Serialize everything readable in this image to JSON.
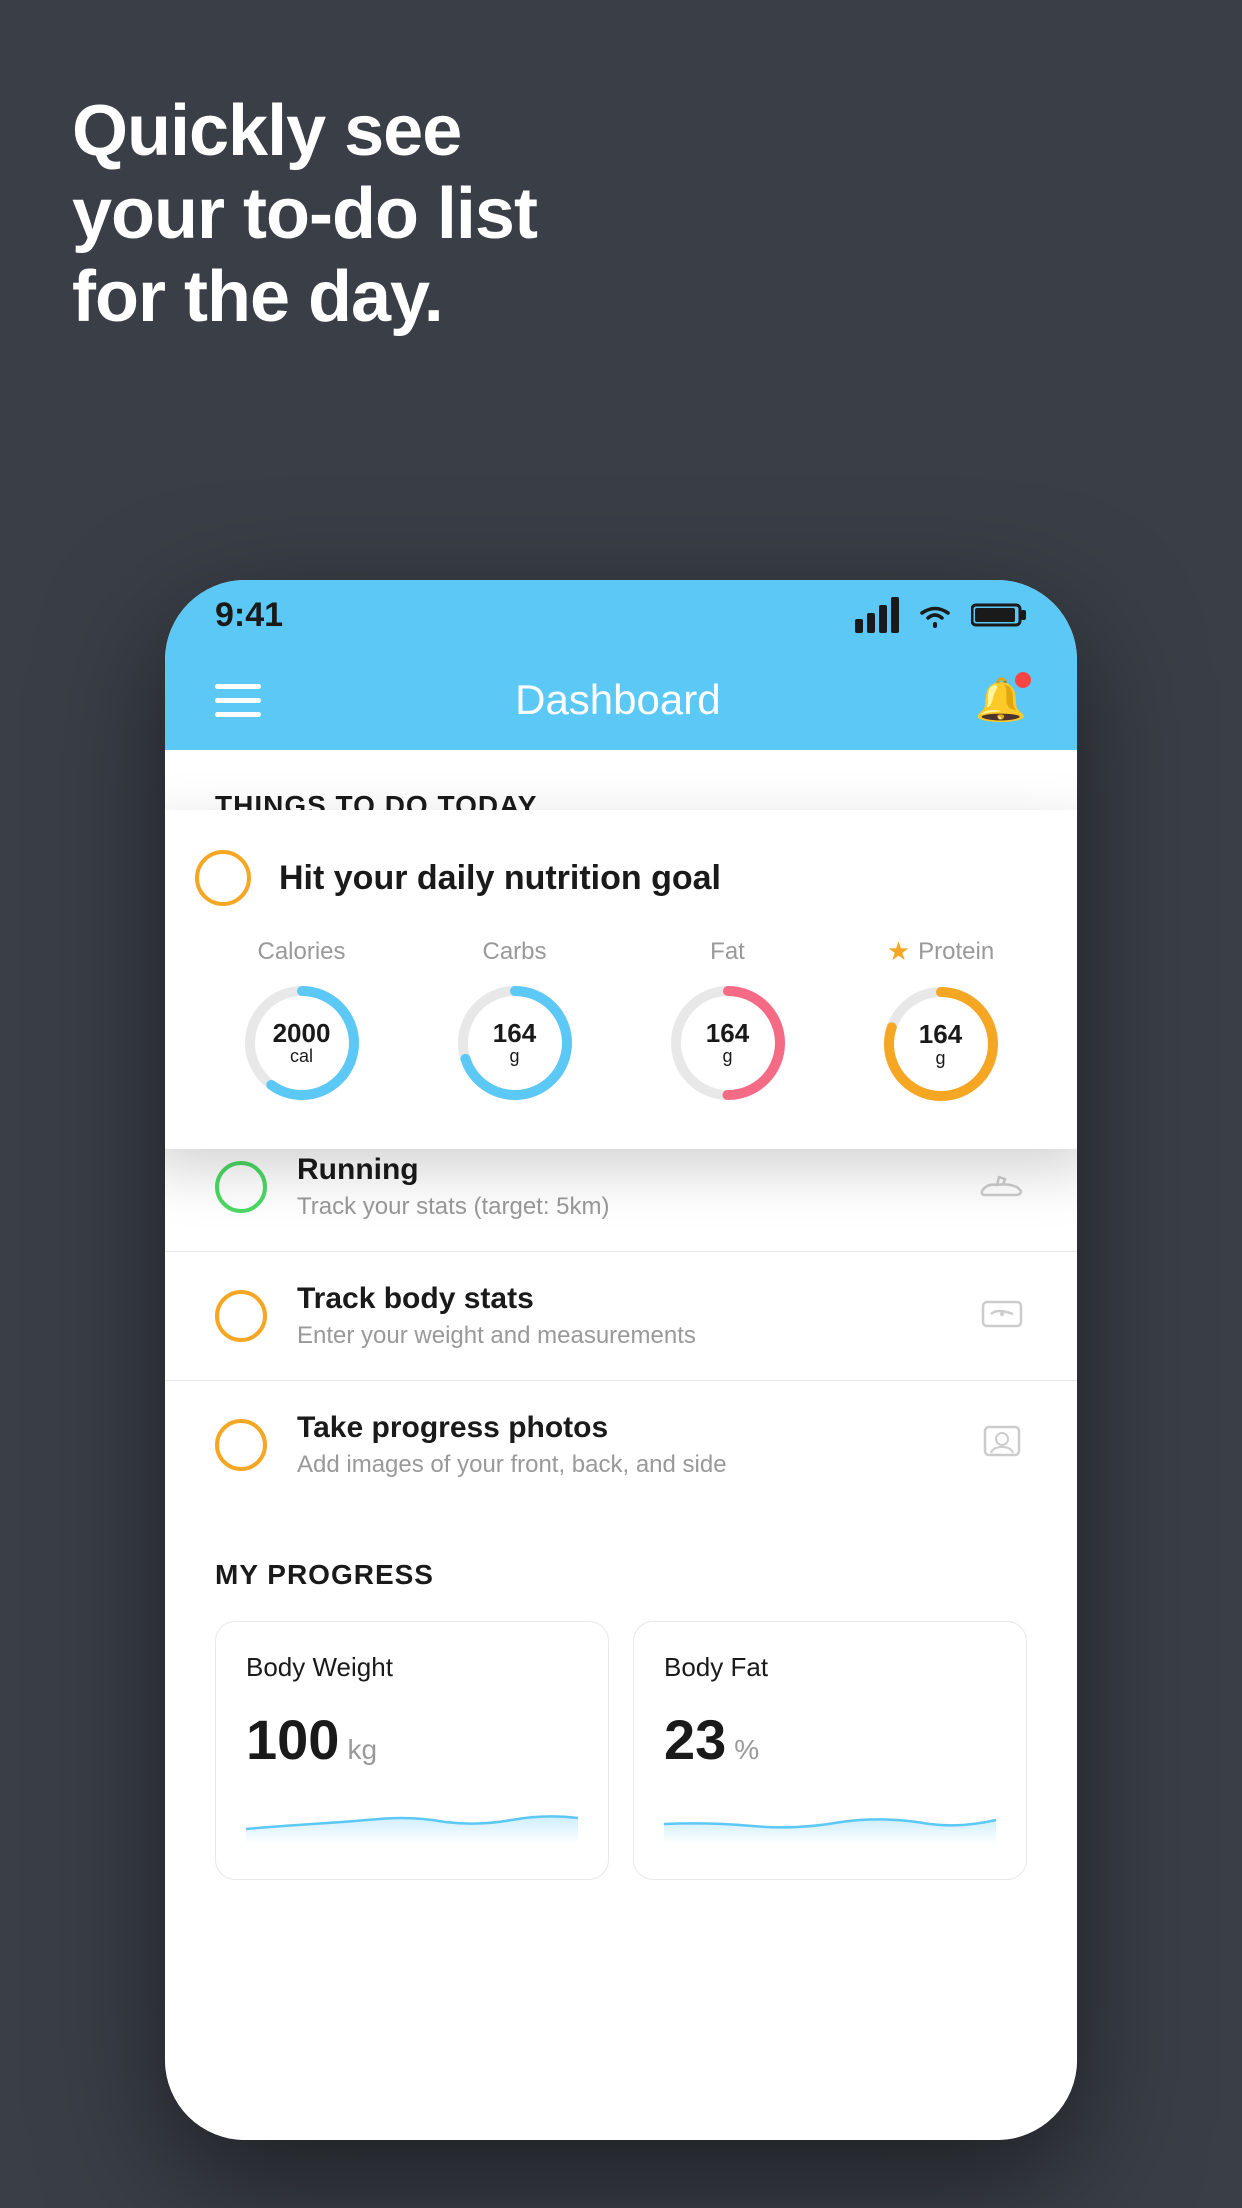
{
  "headline": {
    "line1": "Quickly see",
    "line2": "your to-do list",
    "line3": "for the day."
  },
  "statusBar": {
    "time": "9:41"
  },
  "navbar": {
    "title": "Dashboard"
  },
  "thingsToDoSection": {
    "header": "THINGS TO DO TODAY"
  },
  "nutritionCard": {
    "title": "Hit your daily nutrition goal",
    "macros": [
      {
        "label": "Calories",
        "value": "2000",
        "unit": "cal",
        "color": "#5cc8f5",
        "percent": 60
      },
      {
        "label": "Carbs",
        "value": "164",
        "unit": "g",
        "color": "#5cc8f5",
        "percent": 70
      },
      {
        "label": "Fat",
        "value": "164",
        "unit": "g",
        "color": "#f56a85",
        "percent": 50
      },
      {
        "label": "Protein",
        "value": "164",
        "unit": "g",
        "color": "#f5a623",
        "percent": 80,
        "starred": true
      }
    ]
  },
  "todoItems": [
    {
      "title": "Running",
      "subtitle": "Track your stats (target: 5km)",
      "circleColor": "green",
      "icon": "shoe"
    },
    {
      "title": "Track body stats",
      "subtitle": "Enter your weight and measurements",
      "circleColor": "yellow",
      "icon": "scale"
    },
    {
      "title": "Take progress photos",
      "subtitle": "Add images of your front, back, and side",
      "circleColor": "yellow",
      "icon": "person"
    }
  ],
  "progressSection": {
    "header": "MY PROGRESS",
    "cards": [
      {
        "title": "Body Weight",
        "value": "100",
        "unit": "kg"
      },
      {
        "title": "Body Fat",
        "value": "23",
        "unit": "%"
      }
    ]
  }
}
